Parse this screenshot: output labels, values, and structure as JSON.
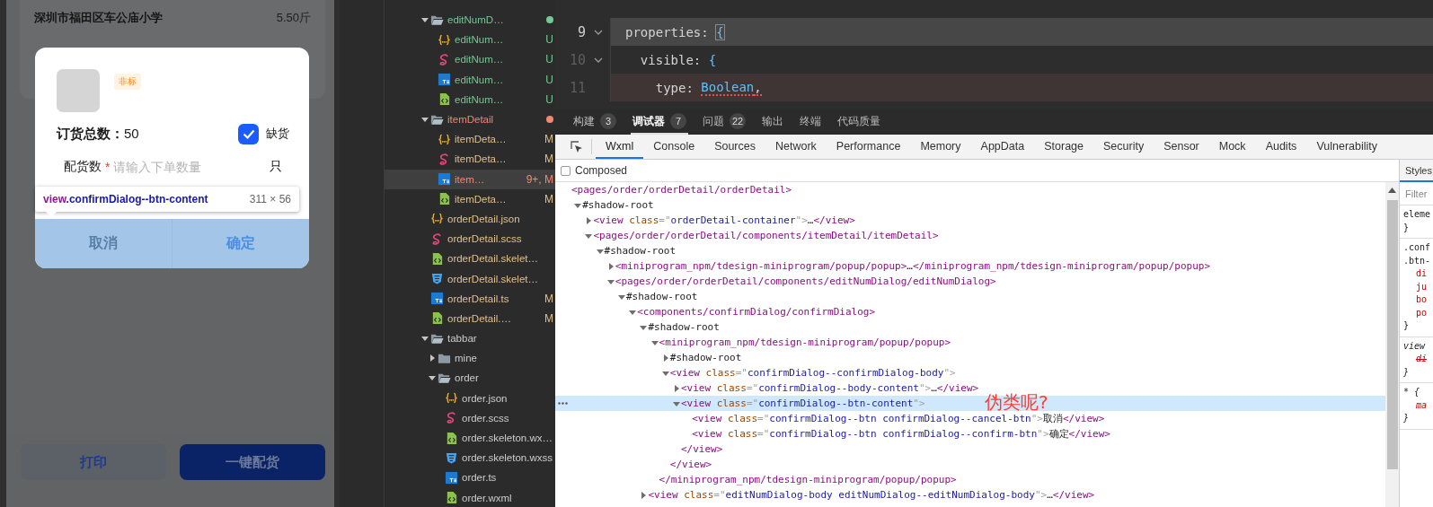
{
  "simulator": {
    "school": "深圳市福田区车公庙小学",
    "weight": "5.50斤",
    "dialog": {
      "tag": "非标",
      "total": "**订货总数：**50",
      "shortage": {
        "label": "缺货",
        "checked": true
      },
      "field": {
        "label": "配货数",
        "required_mark": "*",
        "placeholder": "请输入下单数量",
        "unit": "只"
      },
      "buttons": [
        {
          "label": "取消",
          "kind": "cancel"
        },
        {
          "label": "确定",
          "kind": "confirm"
        }
      ]
    },
    "inspect_tooltip": {
      "selector_tag": "view",
      "selector_class": ".confirmDialog--btn-content",
      "size": "311 × 56"
    },
    "bottom_buttons": [
      {
        "label": "打印",
        "kind": "secondary"
      },
      {
        "label": "一键配货",
        "kind": "primary"
      }
    ]
  },
  "file_tree": [
    {
      "name": "editNumD…",
      "kind": "folder",
      "expanded": true,
      "color": "#73c991",
      "dot": true,
      "selected": false,
      "children": [
        {
          "name": "editNum…",
          "kind": "json",
          "color": "#73c991",
          "badge": "U",
          "selected": false
        },
        {
          "name": "editNum…",
          "kind": "scss",
          "color": "#73c991",
          "badge": "U",
          "selected": false
        },
        {
          "name": "editNum…",
          "kind": "ts",
          "color": "#73c991",
          "badge": "U",
          "selected": false
        },
        {
          "name": "editNum…",
          "kind": "wxml",
          "color": "#73c991",
          "badge": "U",
          "selected": false
        }
      ]
    },
    {
      "name": "itemDetail",
      "kind": "folder",
      "expanded": true,
      "color": "#f48771",
      "dot": true,
      "selected": false,
      "children": [
        {
          "name": "itemDeta…",
          "kind": "json",
          "color": "#e2c08d",
          "badge": "M",
          "selected": false
        },
        {
          "name": "itemDeta…",
          "kind": "scss",
          "color": "#e2c08d",
          "badge": "M",
          "selected": false
        },
        {
          "name": "item…",
          "kind": "ts",
          "color": "#f48771",
          "badge": "9+, M",
          "selected": true
        },
        {
          "name": "itemDeta…",
          "kind": "wxml",
          "color": "#e2c08d",
          "badge": "M",
          "selected": false
        }
      ]
    },
    {
      "name": "orderDetail.json",
      "kind": "json",
      "color": "#e2c08d",
      "selected": false
    },
    {
      "name": "orderDetail.scss",
      "kind": "scss",
      "color": "#e2c08d",
      "selected": false
    },
    {
      "name": "orderDetail.skelet…",
      "kind": "wxml",
      "color": "#e2c08d",
      "selected": false
    },
    {
      "name": "orderDetail.skelet…",
      "kind": "wxss",
      "color": "#e2c08d",
      "selected": false
    },
    {
      "name": "orderDetail.ts",
      "kind": "ts",
      "color": "#e2c08d",
      "badge": "M",
      "selected": false
    },
    {
      "name": "orderDetail.…",
      "kind": "wxml",
      "color": "#e2c08d",
      "badge": "M",
      "selected": false
    },
    {
      "name": "tabbar",
      "kind": "folder",
      "expanded": true,
      "color": "#cccccc",
      "selected": false,
      "children": [
        {
          "name": "mine",
          "kind": "folder",
          "expanded": false,
          "color": "#cccccc",
          "selected": false
        },
        {
          "name": "order",
          "kind": "folder",
          "expanded": true,
          "color": "#cccccc",
          "selected": false,
          "children": [
            {
              "name": "order.json",
              "kind": "json",
              "color": "#cccccc",
              "selected": false
            },
            {
              "name": "order.scss",
              "kind": "scss",
              "color": "#cccccc",
              "selected": false
            },
            {
              "name": "order.skeleton.wx…",
              "kind": "wxml",
              "color": "#cccccc",
              "selected": false
            },
            {
              "name": "order.skeleton.wxss",
              "kind": "wxss",
              "color": "#cccccc",
              "selected": false
            },
            {
              "name": "order.ts",
              "kind": "ts",
              "color": "#cccccc",
              "selected": false
            },
            {
              "name": "order.wxml",
              "kind": "wxml",
              "color": "#cccccc",
              "selected": false
            }
          ]
        }
      ]
    }
  ],
  "editor": {
    "lines": [
      {
        "number": "9",
        "foldable": true,
        "kind": "current",
        "tokens": [
          {
            "text": "properties: ",
            "kind": "plain"
          },
          {
            "text": "{",
            "kind": "bracket"
          }
        ]
      },
      {
        "number": "10",
        "foldable": true,
        "kind": "plain",
        "tokens": [
          {
            "text": "  visible: ",
            "kind": "plain"
          },
          {
            "text": "{",
            "kind": "punct"
          }
        ]
      },
      {
        "number": "11",
        "foldable": false,
        "kind": "error",
        "tokens": [
          {
            "text": "    type: ",
            "kind": "plain"
          },
          {
            "text": "Boolean",
            "kind": "type",
            "error": true
          },
          {
            "text": ",",
            "kind": "plain",
            "error": true
          }
        ]
      }
    ]
  },
  "panel_tabs": [
    {
      "label": "构建",
      "count": "3",
      "selected": false
    },
    {
      "label": "调试器",
      "count": "7",
      "selected": true
    },
    {
      "label": "问题",
      "count": "22",
      "selected": false
    },
    {
      "label": "输出",
      "selected": false
    },
    {
      "label": "终端",
      "selected": false
    },
    {
      "label": "代码质量",
      "selected": false
    }
  ],
  "devtools": {
    "tabs": [
      {
        "label": "Wxml",
        "selected": true
      },
      {
        "label": "Console",
        "selected": false
      },
      {
        "label": "Sources",
        "selected": false
      },
      {
        "label": "Network",
        "selected": false
      },
      {
        "label": "Performance",
        "selected": false
      },
      {
        "label": "Memory",
        "selected": false
      },
      {
        "label": "AppData",
        "selected": false
      },
      {
        "label": "Storage",
        "selected": false
      },
      {
        "label": "Security",
        "selected": false
      },
      {
        "label": "Sensor",
        "selected": false
      },
      {
        "label": "Mock",
        "selected": false
      },
      {
        "label": "Audits",
        "selected": false
      },
      {
        "label": "Vulnerability",
        "selected": false
      }
    ],
    "composed": {
      "label": "Composed",
      "checked": false
    },
    "annotation": "伪类呢?",
    "elements": [
      {
        "line": [
          {
            "kind": "tag",
            "text": "<pages/order/orderDetail/orderDetail>"
          }
        ],
        "selected": false,
        "children": [
          {
            "line": [
              {
                "kind": "text",
                "text": "#shadow-root"
              }
            ],
            "expanded": true,
            "selected": false,
            "children": [
              {
                "line": [
                  {
                    "kind": "tag",
                    "text": "<view"
                  },
                  {
                    "kind": "attr",
                    "text": " class"
                  },
                  {
                    "kind": "punct",
                    "text": "=\""
                  },
                  {
                    "kind": "value",
                    "text": "orderDetail-container"
                  },
                  {
                    "kind": "punct",
                    "text": "\">"
                  },
                  {
                    "kind": "text",
                    "text": "…"
                  },
                  {
                    "kind": "tag",
                    "text": "</view>"
                  }
                ],
                "expanded": false,
                "selected": false
              },
              {
                "line": [
                  {
                    "kind": "tag",
                    "text": "<pages/order/orderDetail/components/itemDetail/itemDetail>"
                  }
                ],
                "expanded": true,
                "selected": false,
                "children": [
                  {
                    "line": [
                      {
                        "kind": "text",
                        "text": "#shadow-root"
                      }
                    ],
                    "expanded": true,
                    "selected": false,
                    "children": [
                      {
                        "line": [
                          {
                            "kind": "tag",
                            "text": "<miniprogram_npm/tdesign-miniprogram/popup/popup>"
                          },
                          {
                            "kind": "text",
                            "text": "…"
                          },
                          {
                            "kind": "tag",
                            "text": "</miniprogram_npm/tdesign-miniprogram/popup/popup>"
                          }
                        ],
                        "expanded": false,
                        "selected": false
                      },
                      {
                        "line": [
                          {
                            "kind": "tag",
                            "text": "<pages/order/orderDetail/components/editNumDialog/editNumDialog>"
                          }
                        ],
                        "expanded": true,
                        "selected": false,
                        "children": [
                          {
                            "line": [
                              {
                                "kind": "text",
                                "text": "#shadow-root"
                              }
                            ],
                            "expanded": true,
                            "selected": false,
                            "children": [
                              {
                                "line": [
                                  {
                                    "kind": "tag",
                                    "text": "<components/confirmDialog/confirmDialog>"
                                  }
                                ],
                                "expanded": true,
                                "selected": false,
                                "children": [
                                  {
                                    "line": [
                                      {
                                        "kind": "text",
                                        "text": "#shadow-root"
                                      }
                                    ],
                                    "expanded": true,
                                    "selected": false,
                                    "children": [
                                      {
                                        "line": [
                                          {
                                            "kind": "tag",
                                            "text": "<miniprogram_npm/tdesign-miniprogram/popup/popup>"
                                          }
                                        ],
                                        "expanded": true,
                                        "selected": false,
                                        "close": [
                                          {
                                            "kind": "tag",
                                            "text": "</miniprogram_npm/tdesign-miniprogram/popup/popup>"
                                          }
                                        ],
                                        "children": [
                                          {
                                            "line": [
                                              {
                                                "kind": "text",
                                                "text": "#shadow-root"
                                              }
                                            ],
                                            "expanded": false,
                                            "selected": false
                                          },
                                          {
                                            "line": [
                                              {
                                                "kind": "tag",
                                                "text": "<view"
                                              },
                                              {
                                                "kind": "attr",
                                                "text": " class"
                                              },
                                              {
                                                "kind": "punct",
                                                "text": "=\""
                                              },
                                              {
                                                "kind": "value",
                                                "text": "confirmDialog--confirmDialog-body"
                                              },
                                              {
                                                "kind": "punct",
                                                "text": "\">"
                                              }
                                            ],
                                            "expanded": true,
                                            "selected": false,
                                            "close": [
                                              {
                                                "kind": "tag",
                                                "text": "</view>"
                                              }
                                            ],
                                            "children": [
                                              {
                                                "line": [
                                                  {
                                                    "kind": "tag",
                                                    "text": "<view"
                                                  },
                                                  {
                                                    "kind": "attr",
                                                    "text": " class"
                                                  },
                                                  {
                                                    "kind": "punct",
                                                    "text": "=\""
                                                  },
                                                  {
                                                    "kind": "value",
                                                    "text": "confirmDialog--body-content"
                                                  },
                                                  {
                                                    "kind": "punct",
                                                    "text": "\">"
                                                  },
                                                  {
                                                    "kind": "text",
                                                    "text": "…"
                                                  },
                                                  {
                                                    "kind": "tag",
                                                    "text": "</view>"
                                                  }
                                                ],
                                                "expanded": false,
                                                "selected": false
                                              },
                                              {
                                                "line": [
                                                  {
                                                    "kind": "tag",
                                                    "text": "<view"
                                                  },
                                                  {
                                                    "kind": "attr",
                                                    "text": " class"
                                                  },
                                                  {
                                                    "kind": "punct",
                                                    "text": "=\""
                                                  },
                                                  {
                                                    "kind": "value",
                                                    "text": "confirmDialog--btn-content"
                                                  },
                                                  {
                                                    "kind": "punct",
                                                    "text": "\">"
                                                  }
                                                ],
                                                "expanded": true,
                                                "selected": true,
                                                "close": [
                                                  {
                                                    "kind": "tag",
                                                    "text": "</view>"
                                                  }
                                                ],
                                                "children": [
                                                  {
                                                    "line": [
                                                      {
                                                        "kind": "tag",
                                                        "text": "<view"
                                                      },
                                                      {
                                                        "kind": "attr",
                                                        "text": " class"
                                                      },
                                                      {
                                                        "kind": "punct",
                                                        "text": "=\""
                                                      },
                                                      {
                                                        "kind": "value",
                                                        "text": "confirmDialog--btn confirmDialog--cancel-btn"
                                                      },
                                                      {
                                                        "kind": "punct",
                                                        "text": "\">"
                                                      },
                                                      {
                                                        "kind": "text",
                                                        "text": "取消"
                                                      },
                                                      {
                                                        "kind": "tag",
                                                        "text": "</view>"
                                                      }
                                                    ],
                                                    "selected": false
                                                  },
                                                  {
                                                    "line": [
                                                      {
                                                        "kind": "tag",
                                                        "text": "<view"
                                                      },
                                                      {
                                                        "kind": "attr",
                                                        "text": " class"
                                                      },
                                                      {
                                                        "kind": "punct",
                                                        "text": "=\""
                                                      },
                                                      {
                                                        "kind": "value",
                                                        "text": "confirmDialog--btn confirmDialog--confirm-btn"
                                                      },
                                                      {
                                                        "kind": "punct",
                                                        "text": "\">"
                                                      },
                                                      {
                                                        "kind": "text",
                                                        "text": "确定"
                                                      },
                                                      {
                                                        "kind": "tag",
                                                        "text": "</view>"
                                                      }
                                                    ],
                                                    "selected": false
                                                  }
                                                ]
                                              }
                                            ]
                                          }
                                        ]
                                      }
                                    ]
                                  },
                                  {
                                    "line": [
                                      {
                                        "kind": "tag",
                                        "text": "<view"
                                      },
                                      {
                                        "kind": "attr",
                                        "text": " class"
                                      },
                                      {
                                        "kind": "punct",
                                        "text": "=\""
                                      },
                                      {
                                        "kind": "value",
                                        "text": "editNumDialog-body editNumDialog--editNumDialog-body"
                                      },
                                      {
                                        "kind": "punct",
                                        "text": "\">"
                                      },
                                      {
                                        "kind": "text",
                                        "text": "…"
                                      },
                                      {
                                        "kind": "tag",
                                        "text": "</view>"
                                      }
                                    ],
                                    "expanded": false,
                                    "selected": false
                                  }
                                ]
                              }
                            ]
                          }
                        ]
                      }
                    ]
                  }
                ]
              }
            ]
          }
        ]
      }
    ],
    "styles": {
      "tab": {
        "label": "Styles",
        "selected": true
      },
      "filter_placeholder": "Filter",
      "rules": [
        {
          "kind": "inline",
          "selector": [
            "eleme"
          ],
          "close": "}"
        },
        {
          "kind": "author",
          "selector": [
            ".conf",
            ".btn-"
          ],
          "props": [
            {
              "text": "di",
              "struck": false
            },
            {
              "text": "ju",
              "struck": false
            },
            {
              "text": "bo",
              "struck": false
            },
            {
              "text": "po",
              "struck": false
            }
          ],
          "close": "}"
        },
        {
          "kind": "user_agent",
          "selector": [
            "view"
          ],
          "props": [
            {
              "text": "di",
              "struck": true
            }
          ],
          "close": "}"
        },
        {
          "kind": "user_agent",
          "selector": [
            "* {"
          ],
          "props": [
            {
              "text": "ma",
              "struck": false
            }
          ],
          "close": "}"
        }
      ]
    }
  }
}
